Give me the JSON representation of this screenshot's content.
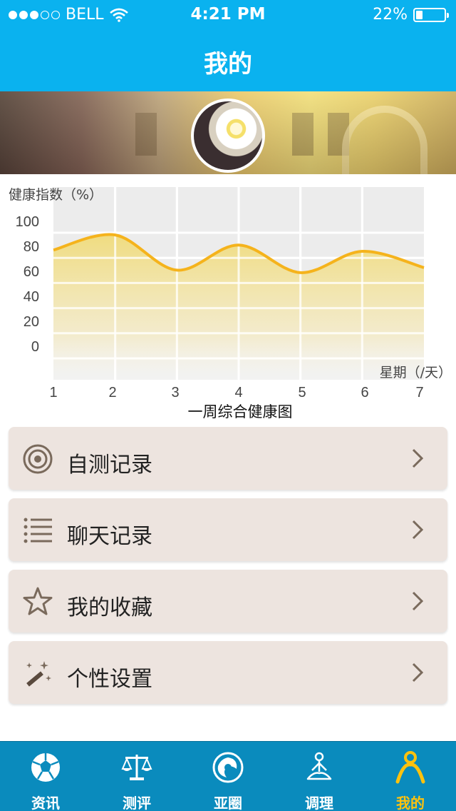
{
  "status_bar": {
    "carrier": "BELL",
    "signal_dots_filled": 3,
    "signal_dots_total": 5,
    "time": "4:21 PM",
    "battery": "22%",
    "battery_level": 0.22
  },
  "nav": {
    "title": "我的"
  },
  "chart_data": {
    "type": "area",
    "title": "一周综合健康图",
    "ylabel": "健康指数（%）",
    "xlabel": "星期（/天）",
    "x": [
      1,
      2,
      3,
      4,
      5,
      6,
      7
    ],
    "series": [
      {
        "values": [
          76,
          88,
          60,
          80,
          58,
          75,
          62
        ]
      }
    ],
    "y_ticks": [
      "100",
      "80",
      "60",
      "40",
      "20",
      "0"
    ],
    "x_ticks": [
      "1",
      "2",
      "3",
      "4",
      "5",
      "6",
      "7"
    ],
    "ylim": [
      0,
      100
    ],
    "grid": true,
    "colors": {
      "line": "#f5b31c",
      "fill": "#f2df86"
    }
  },
  "menu": [
    {
      "label": "自测记录",
      "icon": "target-icon"
    },
    {
      "label": "聊天记录",
      "icon": "list-icon"
    },
    {
      "label": "我的收藏",
      "icon": "star-icon"
    },
    {
      "label": "个性设置",
      "icon": "magic-wand-icon"
    }
  ],
  "tabs": [
    {
      "label": "资讯",
      "icon": "soccer-ball-icon",
      "active": false
    },
    {
      "label": "测评",
      "icon": "scale-icon",
      "active": false
    },
    {
      "label": "亚圈",
      "icon": "swirl-icon",
      "active": false
    },
    {
      "label": "调理",
      "icon": "meditation-icon",
      "active": false
    },
    {
      "label": "我的",
      "icon": "person-icon",
      "active": true
    }
  ],
  "colors": {
    "primary": "#0ab2ef",
    "tabbar": "#0a8bbd",
    "active_tab": "#ffc20e",
    "card": "#ede4df"
  }
}
